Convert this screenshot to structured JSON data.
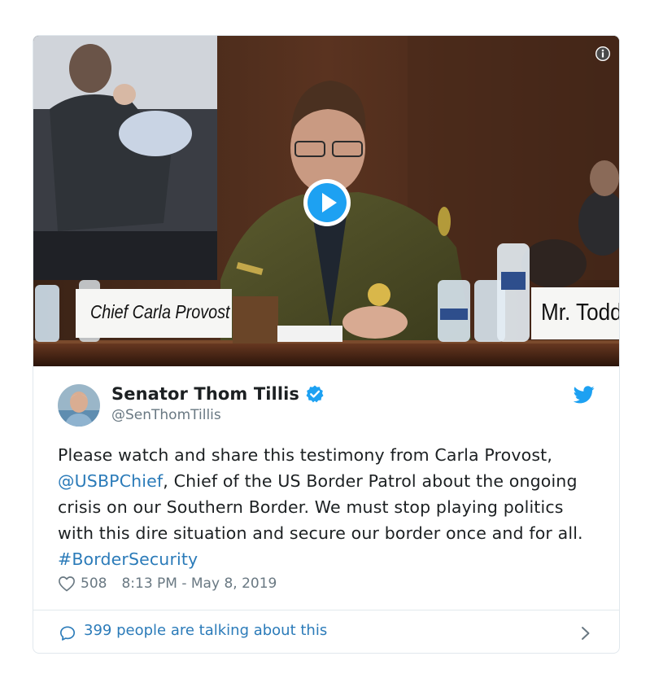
{
  "video": {
    "placard_left": "Chief Carla Provost",
    "placard_right": "Mr. Todd"
  },
  "author": {
    "display_name": "Senator Thom Tillis",
    "handle": "@SenThomTillis",
    "verified": true
  },
  "tweet": {
    "text_part1": "Please watch and share this testimony from Carla Provost, ",
    "mention": "@USBPChief",
    "text_part2": ", Chief of the US Border Patrol about the ongoing crisis on our Southern Border. We must stop playing politics with this dire situation and secure our border once and for all. ",
    "hashtag": "#BorderSecurity",
    "likes": "508",
    "timestamp": "8:13 PM - May 8, 2019"
  },
  "footer": {
    "talking_label": "399 people are talking about this"
  },
  "colors": {
    "link": "#2b7bb9",
    "secondary_text": "#697882",
    "verified_blue": "#1da1f2",
    "border": "#e1e8ed"
  },
  "icons": [
    "info-icon",
    "play-icon",
    "verified-icon",
    "twitter-bird-icon",
    "heart-icon",
    "speech-bubble-icon",
    "chevron-right-icon"
  ]
}
